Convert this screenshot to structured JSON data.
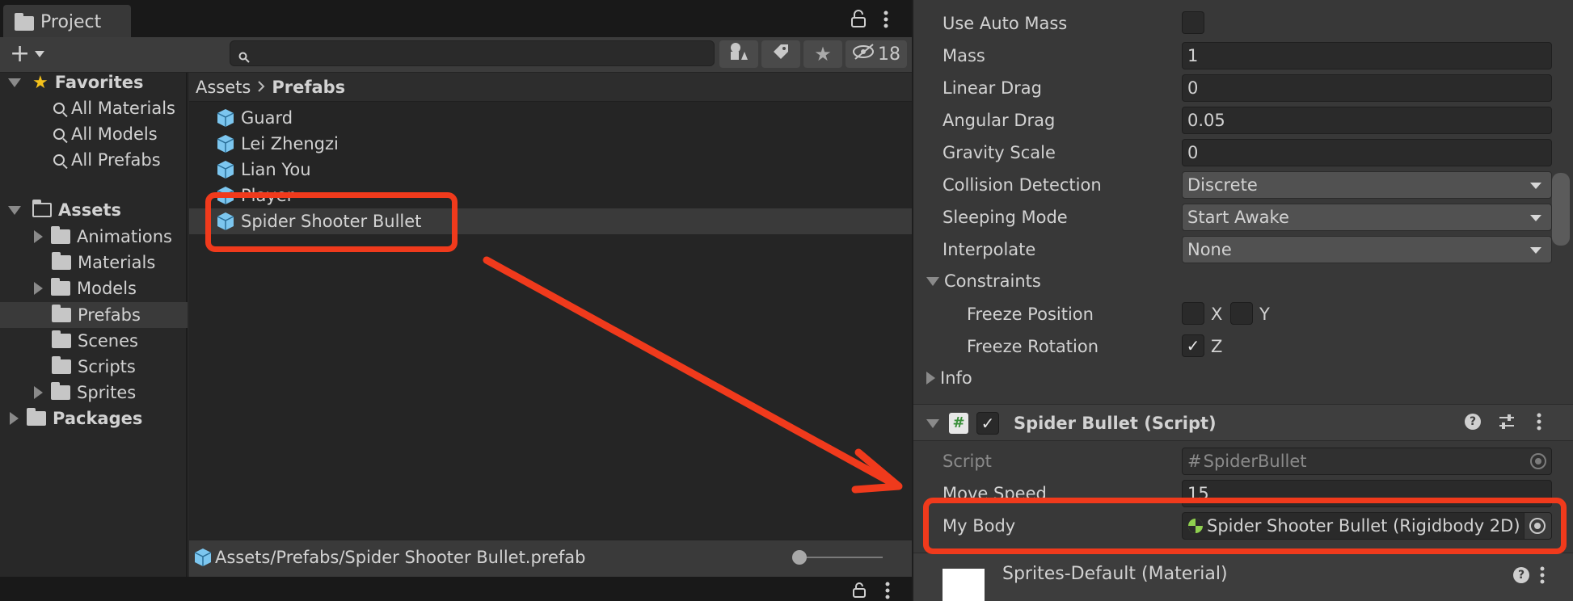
{
  "project_window": {
    "tab_label": "Project",
    "hidden_count": "18",
    "breadcrumb": {
      "root": "Assets",
      "current": "Prefabs"
    },
    "favorites": {
      "label": "Favorites",
      "items": [
        "All Materials",
        "All Models",
        "All Prefabs"
      ]
    },
    "assets": {
      "label": "Assets",
      "folders": [
        "Animations",
        "Materials",
        "Models",
        "Prefabs",
        "Scenes",
        "Scripts",
        "Sprites"
      ]
    },
    "packages_label": "Packages",
    "prefab_items": [
      "Guard",
      "Lei Zhengzi",
      "Lian You",
      "Player",
      "Spider Shooter Bullet"
    ],
    "selected_path": "Assets/Prefabs/Spider Shooter Bullet.prefab"
  },
  "inspector": {
    "rigidbody": {
      "use_auto_mass": {
        "label": "Use Auto Mass",
        "checked": false
      },
      "mass": {
        "label": "Mass",
        "value": "1"
      },
      "linear_drag": {
        "label": "Linear Drag",
        "value": "0"
      },
      "angular_drag": {
        "label": "Angular Drag",
        "value": "0.05"
      },
      "gravity_scale": {
        "label": "Gravity Scale",
        "value": "0"
      },
      "collision_detection": {
        "label": "Collision Detection",
        "value": "Discrete"
      },
      "sleeping_mode": {
        "label": "Sleeping Mode",
        "value": "Start Awake"
      },
      "interpolate": {
        "label": "Interpolate",
        "value": "None"
      },
      "constraints": {
        "label": "Constraints",
        "freeze_position": {
          "label": "Freeze Position",
          "x": "X",
          "y": "Y",
          "x_checked": false,
          "y_checked": false
        },
        "freeze_rotation": {
          "label": "Freeze Rotation",
          "z": "Z",
          "z_checked": true
        }
      },
      "info_label": "Info"
    },
    "script_component": {
      "title": "Spider Bullet (Script)",
      "enabled": true,
      "script": {
        "label": "Script",
        "value": "SpiderBullet"
      },
      "move_speed": {
        "label": "Move Speed",
        "value": "15"
      },
      "my_body": {
        "label": "My Body",
        "value": "Spider Shooter Bullet (Rigidbody 2D)"
      }
    },
    "material": {
      "label": "Sprites-Default (Material)"
    }
  },
  "colors": {
    "annotation": "#f03a1c",
    "selected_row": "#3a3a3a",
    "cube": "#7cc6ef"
  }
}
